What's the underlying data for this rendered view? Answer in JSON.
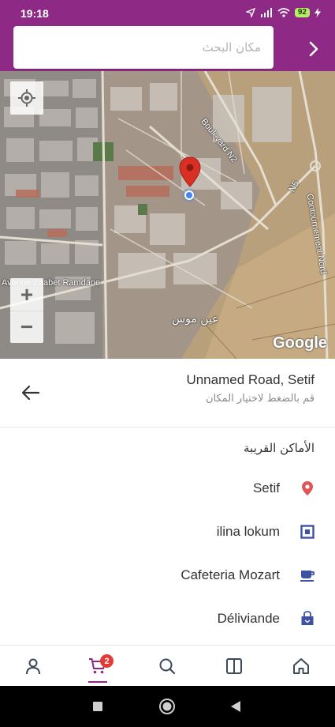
{
  "status_bar": {
    "time": "19:18",
    "battery": "92"
  },
  "search": {
    "placeholder": "مكان البحث"
  },
  "map": {
    "labels": {
      "street_left": "Avenue Zaabet Ramdane",
      "boulevard": "Boulevard N2",
      "road_n": "N5",
      "road_right": "Contournement Nord",
      "district": "عين موس"
    },
    "attribution": "Google",
    "zoom_in": "+",
    "zoom_out": "−"
  },
  "address": {
    "title": "Unnamed Road, Setif",
    "hint": "قم بالضغط لاختيار المكان"
  },
  "nearby": {
    "title": "الأماكن القريبة",
    "places": [
      {
        "name": "Setif",
        "icon": "location-pin-icon",
        "color": "#e05555"
      },
      {
        "name": "ilina lokum",
        "icon": "square-store-icon",
        "color": "#3f51a5"
      },
      {
        "name": "Cafeteria Mozart",
        "icon": "coffee-cup-icon",
        "color": "#3f51a5"
      },
      {
        "name": "Déliviande",
        "icon": "shopping-bag-icon",
        "color": "#3f51a5"
      }
    ]
  },
  "bottom_nav": {
    "cart_count": "2",
    "active": "cart"
  },
  "colors": {
    "brand": "#8e2a86",
    "accent_icon": "#3f51a5",
    "pin": "#d93025",
    "badge": "#e53935"
  }
}
